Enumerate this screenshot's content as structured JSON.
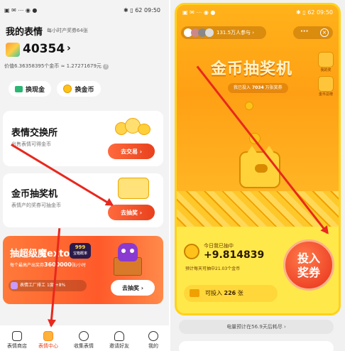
{
  "left": {
    "status": {
      "time": "09:50",
      "battery": "62"
    },
    "title": "我的表情",
    "subtitle": "每小时产奖券64张",
    "balance": "40354",
    "value_line": "价值6.36358395个金币 ≈ 1.27271679元",
    "exchange_cash": "换现金",
    "exchange_coin": "换金币",
    "card1": {
      "title": "表情交换所",
      "desc": "出售表情可得金币",
      "btn": "去交易 ›"
    },
    "card2": {
      "title": "金币抽奖机",
      "desc": "表情产的奖券可抽金币",
      "btn": "去抽奖 ›"
    },
    "promo": {
      "title": "抽超级魔exto",
      "badge": "999",
      "badge_sub": "宝箱概率",
      "rate_prefix": "每个最高产出奖券",
      "rate_value": "3600000",
      "rate_suffix": "张/小时",
      "bonus_label": "表情工厂排工",
      "bonus_value": "1度 +8%",
      "btn": "去抽奖 ›"
    },
    "tabs": [
      "表情商店",
      "表情中心",
      "收集表情",
      "邀请好友",
      "我的"
    ]
  },
  "right": {
    "status": {
      "time": "09:50",
      "battery": "62"
    },
    "participants": "131.5万人参与 ›",
    "hero_title": "金币抽奖机",
    "invested_prefix": "我已投入",
    "invested_value": "7034",
    "invested_suffix": "万张奖券",
    "side_items": [
      "我的奖",
      "金币总榜"
    ],
    "today_label": "今日我已抽中",
    "today_value": "+9.814839",
    "forecast": "预计每天可抽中21.03个金币",
    "big_btn_l1": "投入",
    "big_btn_l2": "奖券",
    "can_invest_prefix": "可投入",
    "can_invest_value": "226",
    "can_invest_suffix": "张",
    "power": "电量预计在56.9天后耗尽 ›"
  }
}
